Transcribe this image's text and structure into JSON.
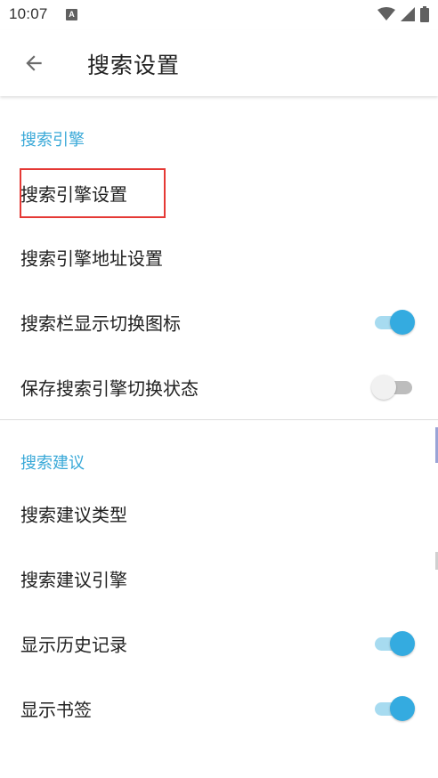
{
  "status_bar": {
    "time": "10:07",
    "notification_icon": "A"
  },
  "app_bar": {
    "title": "搜索设置",
    "back_icon": "arrow-left-icon"
  },
  "sections": [
    {
      "header": "搜索引擎",
      "items": [
        {
          "title": "搜索引擎设置",
          "switch": null
        },
        {
          "title": "搜索引擎地址设置",
          "switch": null
        },
        {
          "title": "搜索栏显示切换图标",
          "switch": true
        },
        {
          "title": "保存搜索引擎切换状态",
          "switch": false
        }
      ]
    },
    {
      "header": "搜索建议",
      "items": [
        {
          "title": "搜索建议类型",
          "switch": null
        },
        {
          "title": "搜索建议引擎",
          "switch": null
        },
        {
          "title": "显示历史记录",
          "switch": true
        },
        {
          "title": "显示书签",
          "switch": true
        }
      ]
    }
  ],
  "colors": {
    "accent": "#34abe0",
    "section_header": "#3aa9d8",
    "highlight": "#e53935"
  }
}
